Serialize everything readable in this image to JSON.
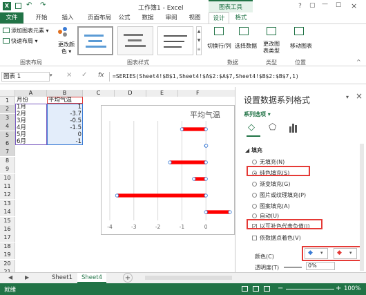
{
  "titlebar": {
    "title": "工作簿1 - Excel",
    "tool_context": "图表工具",
    "help": "?"
  },
  "ribbon_tabs": [
    "文件",
    "开始",
    "插入",
    "页面布局",
    "公式",
    "数据",
    "审阅",
    "视图",
    "设计",
    "格式"
  ],
  "ribbon": {
    "add_element": "添加图表元素 ▾",
    "quick_layout": "快速布局 ▾",
    "change_colors": "更改颜色 ▾",
    "switch_rowcol": "切换行/列",
    "select_data": "选择数据",
    "change_type": "更改图表类型",
    "move_chart": "移动图表",
    "groups": {
      "layouts": "图表布局",
      "styles": "图表样式",
      "data": "数据",
      "type": "类型",
      "location": "位置"
    }
  },
  "formula": {
    "namebox": "图表 1",
    "fx": "fx",
    "formula": "=SERIES(Sheet4!$B$1,Sheet4!$A$2:$A$7,Sheet4!$B$2:$B$7,1)"
  },
  "columns": [
    "A",
    "B",
    "C",
    "D",
    "E",
    "F"
  ],
  "rows": [
    "1",
    "2",
    "3",
    "4",
    "5",
    "6",
    "7",
    "8",
    "9",
    "10",
    "11",
    "12",
    "13",
    "14",
    "15",
    "16",
    "17",
    "18",
    "19",
    "20",
    "21"
  ],
  "table": {
    "headers": [
      "月份",
      "平均气温"
    ],
    "months": [
      "1月",
      "2月",
      "3月",
      "4月",
      "5月",
      "6月"
    ],
    "temps": [
      "1",
      "-3.7",
      "-0.5",
      "-1.5",
      "0",
      "-1"
    ]
  },
  "chart_data": {
    "type": "bar",
    "title": "平均气温",
    "categories": [
      "1月",
      "2月",
      "3月",
      "4月",
      "5月",
      "6月"
    ],
    "values": [
      1,
      -3.7,
      -0.5,
      -1.5,
      0,
      -1
    ],
    "xlim": [
      -4,
      1
    ],
    "xticks": [
      "-4",
      "-3",
      "-2",
      "-1",
      "0"
    ],
    "bar_color": "#ff0000"
  },
  "pane": {
    "title": "设置数据系列格式",
    "close": "×",
    "series_options": "系列选项 ▾",
    "section": "填充",
    "options": [
      {
        "label": "无填充(N)",
        "type": "radio",
        "on": false
      },
      {
        "label": "纯色填充(S)",
        "type": "radio",
        "on": true
      },
      {
        "label": "渐变填充(G)",
        "type": "radio",
        "on": false
      },
      {
        "label": "图片或纹理填充(P)",
        "type": "radio",
        "on": false
      },
      {
        "label": "图案填充(A)",
        "type": "radio",
        "on": false
      },
      {
        "label": "自动(U)",
        "type": "radio",
        "on": false
      },
      {
        "label": "以互补色代表负值(I)",
        "type": "check",
        "on": true
      },
      {
        "label": "依数据点着色(V)",
        "type": "check",
        "on": false
      }
    ],
    "color_label": "颜色(C)",
    "transparency_label": "透明度(T)",
    "transparency_value": "0%"
  },
  "sheets": {
    "tab1": "Sheet1",
    "tab2": "Sheet4",
    "add": "+"
  },
  "status": {
    "ready": "就绪",
    "zoom": "100%"
  },
  "colors": {
    "excel_green": "#217346",
    "highlight": "#e53935"
  }
}
